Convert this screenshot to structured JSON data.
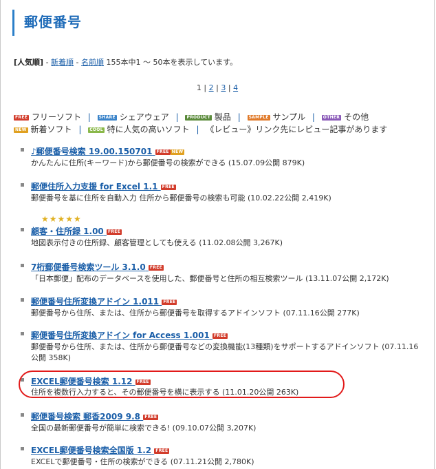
{
  "page": {
    "title": "郵便番号"
  },
  "sort": {
    "current": "[人気順]",
    "dash1": "-",
    "new_link": "新着順",
    "dash2": "-",
    "name_link": "名前順",
    "summary": "155本中1 〜 50本を表示しています。"
  },
  "pager": {
    "current": "1",
    "pages": [
      "2",
      "3",
      "4"
    ]
  },
  "legend": {
    "free_badge": "FREE",
    "free_label": "フリーソフト",
    "share_badge": "SHARE",
    "share_label": "シェアウェア",
    "product_badge": "PRODUCT",
    "product_label": "製品",
    "sample_badge": "SAMPLE",
    "sample_label": "サンプル",
    "other_badge": "OTHER",
    "other_label": "その他",
    "new_badge": "NEW",
    "new_label": "新着ソフト",
    "cool_badge": "COOL",
    "cool_label": "特に人気の高いソフト",
    "review_note": "《レビュー》リンク先にレビュー記事があります"
  },
  "items": [
    {
      "name": "♪郵便番号検索 19.00.150701",
      "badges": [
        "FREE",
        "NEW"
      ],
      "desc": "かんたんに住所(キーワード)から郵便番号の検索ができる (15.07.09公開 879K)"
    },
    {
      "name": "郵便住所入力支援 for Excel 1.1",
      "badges": [
        "FREE"
      ],
      "desc": "郵便番号を基に住所を自動入力 住所から郵便番号の検索も可能 (10.02.22公開 2,419K)",
      "stars": "★★★★★"
    },
    {
      "name": "顧客・住所録 1.00",
      "badges": [
        "FREE"
      ],
      "desc": "地図表示付きの住所録、顧客管理としても使える (11.02.08公開 3,267K)"
    },
    {
      "name": "7桁郵便番号検索ツール 3.1.0",
      "badges": [
        "FREE"
      ],
      "desc": "「日本郵便」配布のデータベースを使用した、郵便番号と住所の相互検索ツール (13.11.07公開 2,172K)"
    },
    {
      "name": "郵便番号住所変換アドイン 1.011",
      "badges": [
        "FREE"
      ],
      "desc": "郵便番号から住所、または、住所から郵便番号を取得するアドインソフト (07.11.16公開 277K)"
    },
    {
      "name": "郵便番号住所変換アドイン for Access 1.001",
      "badges": [
        "FREE"
      ],
      "desc": "郵便番号から住所、または、住所から郵便番号などの変換機能(13種類)をサポートするアドインソフト (07.11.16公開 358K)"
    },
    {
      "name": "EXCEL郵便番号検索 1.12",
      "badges": [
        "FREE"
      ],
      "desc": "住所を複数行入力すると、その郵便番号を横に表示する (11.01.20公開 263K)"
    },
    {
      "name": "郵便番号検索 郵香2009 9.8",
      "badges": [
        "FREE"
      ],
      "desc": "全国の最新郵便番号が簡単に検索できる! (09.10.07公開 3,207K)"
    },
    {
      "name": "EXCEL郵便番号検索全国版 1.2",
      "badges": [
        "FREE"
      ],
      "desc": "EXCELで郵便番号・住所の検索ができる (07.11.21公開 2,780K)"
    }
  ],
  "colors": {
    "link": "#1a5ea8",
    "title": "#1e6bb8",
    "highlight": "#e21a1a",
    "free": "#d23c2b"
  }
}
